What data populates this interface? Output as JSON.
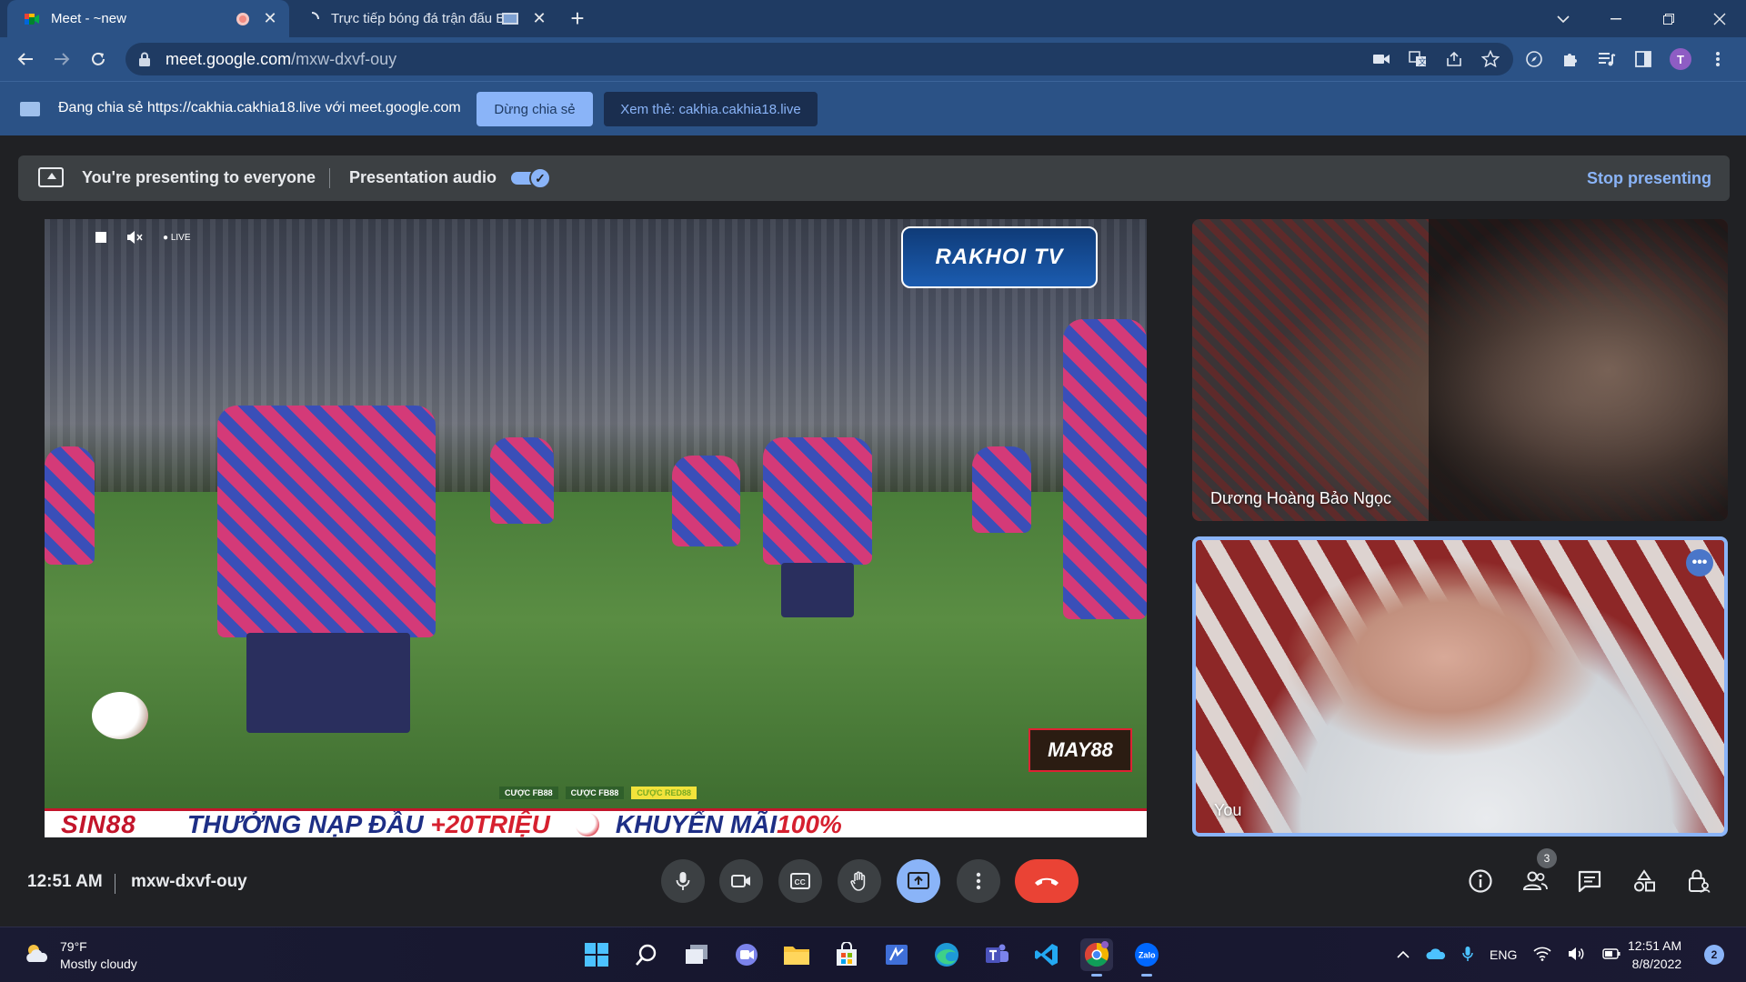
{
  "browser": {
    "tabs": [
      {
        "title": "Meet - ~new",
        "active": true
      },
      {
        "title": "Trực tiếp bóng đá trận đấu B",
        "active": false
      }
    ],
    "url_host": "meet.google.com",
    "url_path": "/mxw-dxvf-ouy",
    "profile_initial": "T"
  },
  "infobar": {
    "text": "Đang chia sẻ https://cakhia.cakhia18.live với meet.google.com",
    "stop_share_label": "Dừng chia sẻ",
    "view_tab_label": "Xem thẻ: cakhia.cakhia18.live"
  },
  "present_bar": {
    "status": "You're presenting to everyone",
    "audio_label": "Presentation audio",
    "audio_enabled": true,
    "stop_label": "Stop presenting"
  },
  "stage": {
    "live_label": "● LIVE",
    "brand_text": "RAKHOI TV",
    "sponsor_logo": "MAY88",
    "bet_tags": [
      "CƯỢC FB88",
      "CƯỢC FB88",
      "CƯỢC RED88"
    ],
    "banner_brand": "SIN88",
    "banner_promo1_a": "THƯỞNG NẠP ĐẦU",
    "banner_promo1_b": "+20TRIỆU",
    "banner_promo2_a": "KHUYẾN MÃI",
    "banner_promo2_b": "100%"
  },
  "participants": [
    {
      "name": "Dương Hoàng Bảo Ngọc"
    },
    {
      "name": "You"
    }
  ],
  "footer": {
    "time": "12:51 AM",
    "meeting_code": "mxw-dxvf-ouy",
    "people_count": "3"
  },
  "taskbar": {
    "weather_temp": "79°F",
    "weather_desc": "Mostly cloudy",
    "language": "ENG",
    "time": "12:51 AM",
    "date": "8/8/2022",
    "notifications": "2"
  },
  "colors": {
    "accent": "#8ab4f8",
    "leave": "#ea4335",
    "browser_frame": "#2b5286"
  }
}
